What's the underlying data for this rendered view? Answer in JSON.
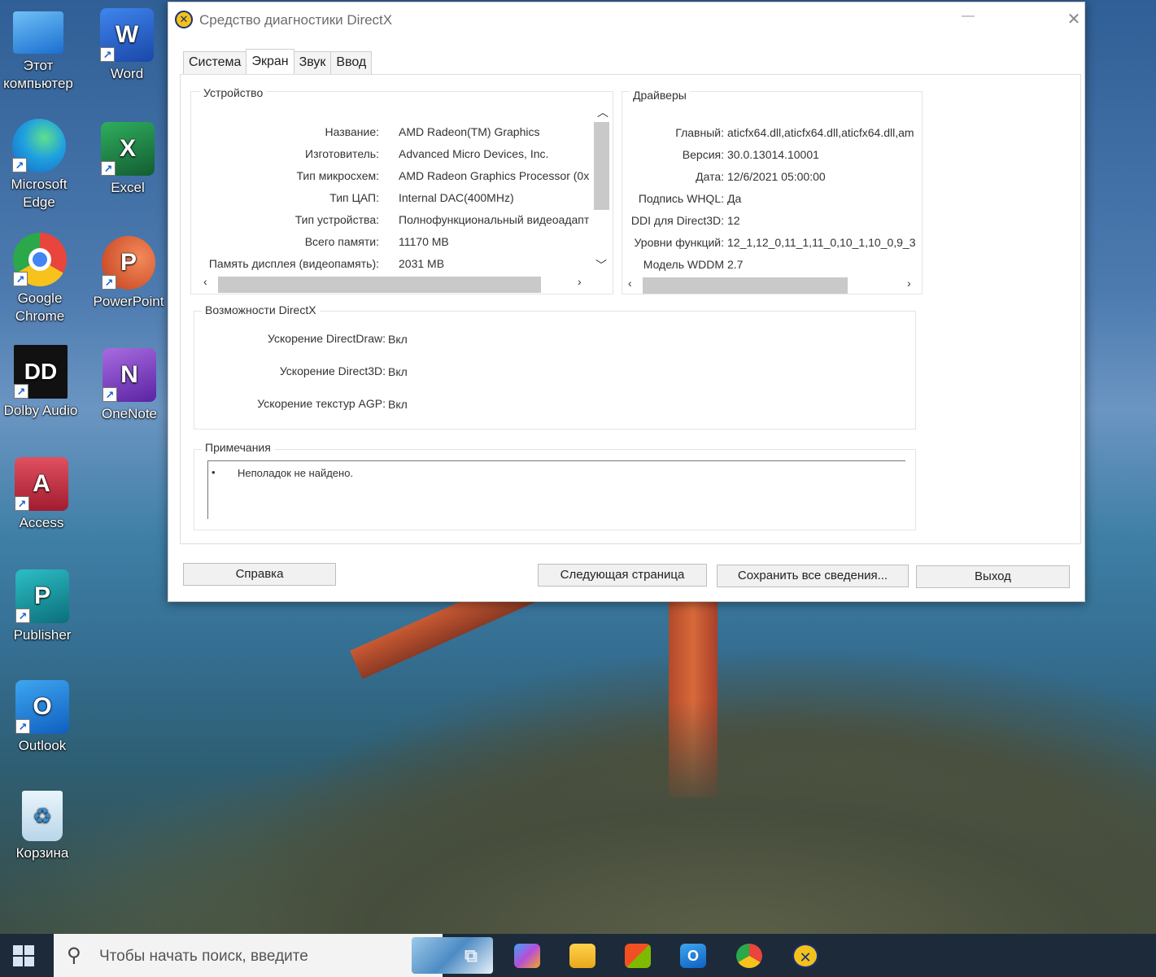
{
  "window": {
    "title": "Средство диагностики DirectX",
    "minimize_glyph": "—",
    "close_glyph": "✕"
  },
  "tabs": [
    {
      "label": "Система",
      "active": false
    },
    {
      "label": "Экран",
      "active": true
    },
    {
      "label": "Звук",
      "active": false
    },
    {
      "label": "Ввод",
      "active": false
    }
  ],
  "device": {
    "title": "Устройство",
    "rows": [
      {
        "label": "Название:",
        "value": "AMD Radeon(TM) Graphics"
      },
      {
        "label": "Изготовитель:",
        "value": "Advanced Micro Devices, Inc."
      },
      {
        "label": "Тип микросхем:",
        "value": "AMD Radeon Graphics Processor (0x"
      },
      {
        "label": "Тип ЦАП:",
        "value": "Internal DAC(400MHz)"
      },
      {
        "label": "Тип устройства:",
        "value": "Полнофункциональный видеоадапт"
      },
      {
        "label": "Всего памяти:",
        "value": "11170 MB"
      },
      {
        "label": "Память дисплея (видеопамять):",
        "value": "2031 MB"
      }
    ]
  },
  "drivers": {
    "title": "Драйверы",
    "rows": [
      {
        "label": "Главный:",
        "value": "aticfx64.dll,aticfx64.dll,aticfx64.dll,am"
      },
      {
        "label": "Версия:",
        "value": "30.0.13014.10001"
      },
      {
        "label": "Дата:",
        "value": "12/6/2021 05:00:00"
      },
      {
        "label": "Подпись WHQL:",
        "value": "Да"
      },
      {
        "label": "DDI для Direct3D:",
        "value": "12"
      },
      {
        "label": "Уровни функций:",
        "value": "12_1,12_0,11_1,11_0,10_1,10_0,9_3"
      },
      {
        "label": "Модель WDDM",
        "value": "2.7"
      }
    ]
  },
  "directx": {
    "title": "Возможности DirectX",
    "rows": [
      {
        "label": "Ускорение DirectDraw:",
        "value": "Вкл"
      },
      {
        "label": "Ускорение Direct3D:",
        "value": "Вкл"
      },
      {
        "label": "Ускорение текстур AGP:",
        "value": "Вкл"
      }
    ]
  },
  "notes": {
    "title": "Примечания",
    "bullet": "•",
    "items": [
      "Неполадок не найдено."
    ]
  },
  "buttons": {
    "help": "Справка",
    "next_page": "Следующая страница",
    "save_all": "Сохранить все сведения...",
    "exit": "Выход"
  },
  "desktop_icons": [
    {
      "label": "Этот компьютер",
      "icon": "computer-icon",
      "color": "#3d8fe0"
    },
    {
      "label": "Word",
      "icon": "word-icon",
      "color": "#2b5fc7",
      "letter": "W"
    },
    {
      "label": "Microsoft Edge",
      "icon": "edge-icon",
      "color": "#1787d6"
    },
    {
      "label": "Excel",
      "icon": "excel-icon",
      "color": "#1e7a44",
      "letter": "X"
    },
    {
      "label": "Google Chrome",
      "icon": "chrome-icon",
      "color": "#e8453c"
    },
    {
      "label": "PowerPoint",
      "icon": "powerpoint-icon",
      "color": "#d24726",
      "letter": "P"
    },
    {
      "label": "Dolby Audio",
      "icon": "dolby-icon",
      "color": "#111111",
      "letter": "DD"
    },
    {
      "label": "OneNote",
      "icon": "onenote-icon",
      "color": "#7d3cc4",
      "letter": "N"
    },
    {
      "label": "Access",
      "icon": "access-icon",
      "color": "#b8263b",
      "letter": "A"
    },
    {
      "label": "Publisher",
      "icon": "publisher-icon",
      "color": "#0b7d86",
      "letter": "P"
    },
    {
      "label": "Outlook",
      "icon": "outlook-icon",
      "color": "#1366c8",
      "letter": "O"
    },
    {
      "label": "Корзина",
      "icon": "recycle-bin-icon",
      "color": "#cfe4f2"
    }
  ],
  "taskbar": {
    "search_placeholder": "Чтобы начать поиск, введите",
    "apps": [
      "task-view-icon",
      "copilot-icon",
      "file-explorer-icon",
      "store-icon",
      "outlook-icon",
      "chrome-icon",
      "directx-diag-icon"
    ]
  }
}
